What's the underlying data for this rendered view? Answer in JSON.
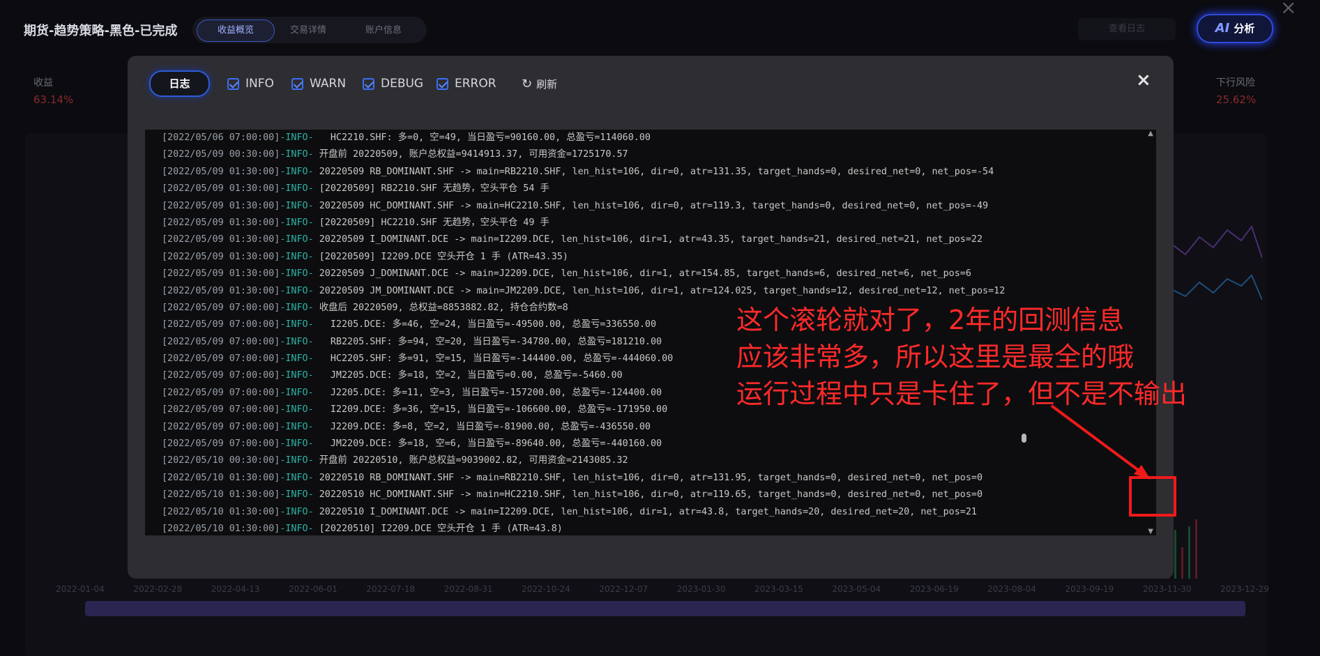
{
  "background": {
    "title": "期货-趋势策略-黑色-已完成",
    "tabs": [
      "收益概览",
      "交易详情",
      "账户信息"
    ],
    "ghost_button": "查看日志",
    "ai_button": {
      "prefix": "AI",
      "label": "分析"
    },
    "metric_left": {
      "label": "收益",
      "value": "63.14%"
    },
    "metric_right": {
      "label": "下行风险",
      "value": "25.62%"
    },
    "axis_dates": [
      "2022-01-04",
      "2022-02-28",
      "2022-04-13",
      "2022-06-01",
      "2022-07-18",
      "2022-08-31",
      "2022-10-24",
      "2022-12-07",
      "2023-01-30",
      "2023-03-15",
      "2023-05-04",
      "2023-06-19",
      "2023-08-04",
      "2023-09-19",
      "2023-11-30",
      "2023-12-29"
    ]
  },
  "modal": {
    "log_tab": "日志",
    "filters": [
      {
        "label": "INFO",
        "checked": true
      },
      {
        "label": "WARN",
        "checked": true
      },
      {
        "label": "DEBUG",
        "checked": true
      },
      {
        "label": "ERROR",
        "checked": true
      }
    ],
    "refresh_label": "刷新",
    "close_icon": "×",
    "log_lines": [
      {
        "ts": "[2022/05/06 07:00:00]",
        "lvl": "-INFO-",
        "msg": "   HC2210.SHF: 多=0, 空=49, 当日盈亏=90160.00, 总盈亏=114060.00"
      },
      {
        "ts": "[2022/05/09 00:30:00]",
        "lvl": "-INFO-",
        "msg": " 开盘前 20220509, 账户总权益=9414913.37, 可用资金=1725170.57"
      },
      {
        "ts": "[2022/05/09 01:30:00]",
        "lvl": "-INFO-",
        "msg": " 20220509 RB_DOMINANT.SHF -> main=RB2210.SHF, len_hist=106, dir=0, atr=131.35, target_hands=0, desired_net=0, net_pos=-54"
      },
      {
        "ts": "[2022/05/09 01:30:00]",
        "lvl": "-INFO-",
        "msg": " [20220509] RB2210.SHF 无趋势，空头平仓 54 手"
      },
      {
        "ts": "[2022/05/09 01:30:00]",
        "lvl": "-INFO-",
        "msg": " 20220509 HC_DOMINANT.SHF -> main=HC2210.SHF, len_hist=106, dir=0, atr=119.3, target_hands=0, desired_net=0, net_pos=-49"
      },
      {
        "ts": "[2022/05/09 01:30:00]",
        "lvl": "-INFO-",
        "msg": " [20220509] HC2210.SHF 无趋势，空头平仓 49 手"
      },
      {
        "ts": "[2022/05/09 01:30:00]",
        "lvl": "-INFO-",
        "msg": " 20220509 I_DOMINANT.DCE -> main=I2209.DCE, len_hist=106, dir=1, atr=43.35, target_hands=21, desired_net=21, net_pos=22"
      },
      {
        "ts": "[2022/05/09 01:30:00]",
        "lvl": "-INFO-",
        "msg": " [20220509] I2209.DCE 空头开仓 1 手 (ATR=43.35)"
      },
      {
        "ts": "[2022/05/09 01:30:00]",
        "lvl": "-INFO-",
        "msg": " 20220509 J_DOMINANT.DCE -> main=J2209.DCE, len_hist=106, dir=1, atr=154.85, target_hands=6, desired_net=6, net_pos=6"
      },
      {
        "ts": "[2022/05/09 01:30:00]",
        "lvl": "-INFO-",
        "msg": " 20220509 JM_DOMINANT.DCE -> main=JM2209.DCE, len_hist=106, dir=1, atr=124.025, target_hands=12, desired_net=12, net_pos=12"
      },
      {
        "ts": "[2022/05/09 07:00:00]",
        "lvl": "-INFO-",
        "msg": " 收盘后 20220509, 总权益=8853882.82, 持仓合约数=8"
      },
      {
        "ts": "[2022/05/09 07:00:00]",
        "lvl": "-INFO-",
        "msg": "   I2205.DCE: 多=46, 空=24, 当日盈亏=-49500.00, 总盈亏=336550.00"
      },
      {
        "ts": "[2022/05/09 07:00:00]",
        "lvl": "-INFO-",
        "msg": "   RB2205.SHF: 多=94, 空=20, 当日盈亏=-34780.00, 总盈亏=181210.00"
      },
      {
        "ts": "[2022/05/09 07:00:00]",
        "lvl": "-INFO-",
        "msg": "   HC2205.SHF: 多=91, 空=15, 当日盈亏=-144400.00, 总盈亏=-444060.00"
      },
      {
        "ts": "[2022/05/09 07:00:00]",
        "lvl": "-INFO-",
        "msg": "   JM2205.DCE: 多=18, 空=2, 当日盈亏=0.00, 总盈亏=-5460.00"
      },
      {
        "ts": "[2022/05/09 07:00:00]",
        "lvl": "-INFO-",
        "msg": "   J2205.DCE: 多=11, 空=3, 当日盈亏=-157200.00, 总盈亏=-124400.00"
      },
      {
        "ts": "[2022/05/09 07:00:00]",
        "lvl": "-INFO-",
        "msg": "   I2209.DCE: 多=36, 空=15, 当日盈亏=-106600.00, 总盈亏=-171950.00"
      },
      {
        "ts": "[2022/05/09 07:00:00]",
        "lvl": "-INFO-",
        "msg": "   J2209.DCE: 多=8, 空=2, 当日盈亏=-81900.00, 总盈亏=-436550.00"
      },
      {
        "ts": "[2022/05/09 07:00:00]",
        "lvl": "-INFO-",
        "msg": "   JM2209.DCE: 多=18, 空=6, 当日盈亏=-89640.00, 总盈亏=-440160.00"
      },
      {
        "ts": "[2022/05/10 00:30:00]",
        "lvl": "-INFO-",
        "msg": " 开盘前 20220510, 账户总权益=9039002.82, 可用资金=2143085.32"
      },
      {
        "ts": "[2022/05/10 01:30:00]",
        "lvl": "-INFO-",
        "msg": " 20220510 RB_DOMINANT.SHF -> main=RB2210.SHF, len_hist=106, dir=0, atr=131.95, target_hands=0, desired_net=0, net_pos=0"
      },
      {
        "ts": "[2022/05/10 01:30:00]",
        "lvl": "-INFO-",
        "msg": " 20220510 HC_DOMINANT.SHF -> main=HC2210.SHF, len_hist=106, dir=0, atr=119.65, target_hands=0, desired_net=0, net_pos=0"
      },
      {
        "ts": "[2022/05/10 01:30:00]",
        "lvl": "-INFO-",
        "msg": " 20220510 I_DOMINANT.DCE -> main=I2209.DCE, len_hist=106, dir=1, atr=43.8, target_hands=20, desired_net=20, net_pos=21"
      },
      {
        "ts": "[2022/05/10 01:30:00]",
        "lvl": "-INFO-",
        "msg": " [20220510] I2209.DCE 空头开仓 1 手 (ATR=43.8)"
      }
    ]
  },
  "annotation": {
    "lines": [
      "这个滚轮就对了，2年的回测信息",
      "应该非常多，所以这里是最全的哦",
      "运行过程中只是卡住了，但不是不输出"
    ],
    "color": "#ff2a2a"
  }
}
